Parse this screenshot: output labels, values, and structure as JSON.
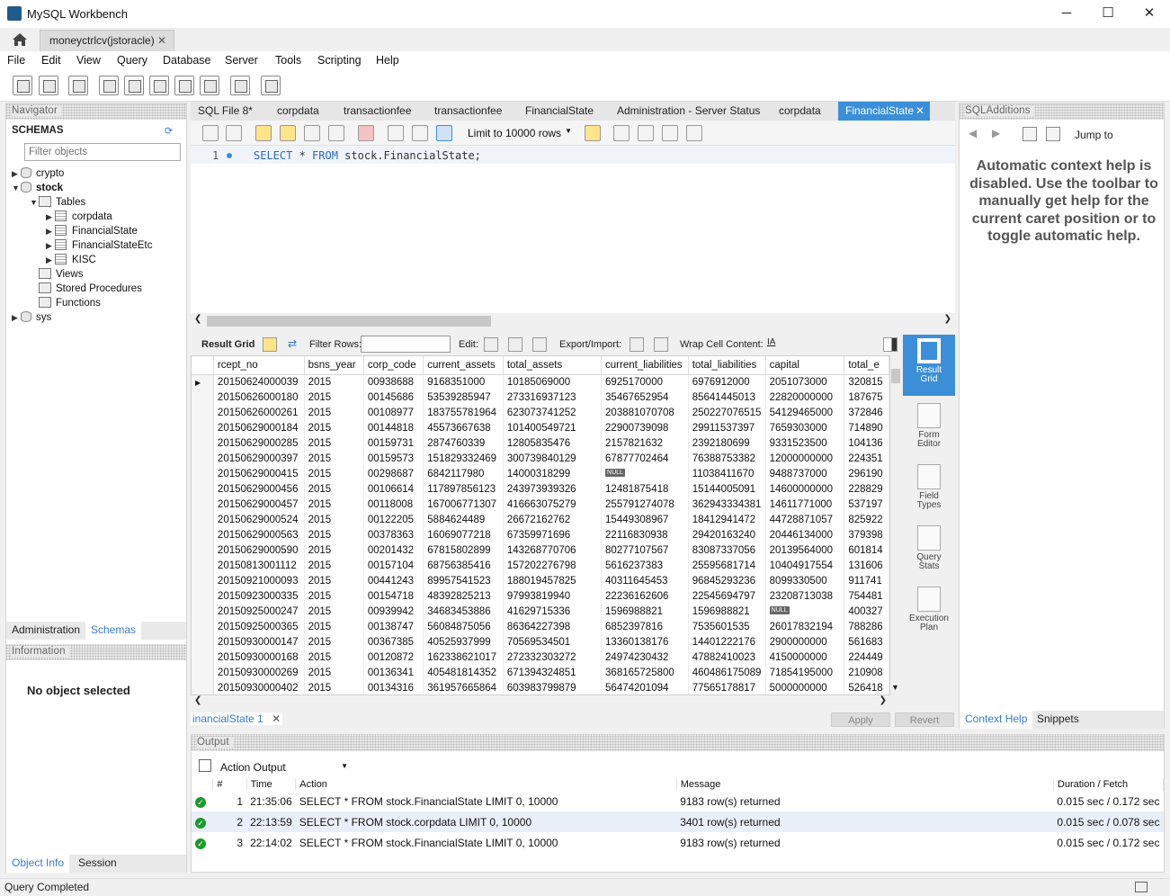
{
  "window": {
    "title": "MySQL Workbench",
    "minimize": "─",
    "maximize": "☐",
    "close": "✕"
  },
  "connection_tab": {
    "label": "moneyctrlcv(jstoracle)",
    "close": "✕"
  },
  "menu": [
    "File",
    "Edit",
    "View",
    "Query",
    "Database",
    "Server",
    "Tools",
    "Scripting",
    "Help"
  ],
  "navigator": {
    "title": "Navigator",
    "schemas_label": "SCHEMAS",
    "filter_placeholder": "Filter objects",
    "tree": {
      "crypto": "crypto",
      "stock": "stock",
      "tables": "Tables",
      "corpdata": "corpdata",
      "financialstate": "FinancialState",
      "financialstateetc": "FinancialStateEtc",
      "kisc": "KISC",
      "views": "Views",
      "procedures": "Stored Procedures",
      "functions": "Functions",
      "sys": "sys"
    },
    "tabs": [
      "Administration",
      "Schemas"
    ],
    "info_title": "Information",
    "no_object": "No object selected",
    "bottom_tabs": [
      "Object Info",
      "Session"
    ]
  },
  "editor_tabs": [
    "SQL File 8*",
    "corpdata",
    "transactionfee",
    "transactionfee",
    "FinancialState",
    "Administration - Server Status",
    "corpdata",
    "FinancialState"
  ],
  "editor": {
    "limit": "Limit to 10000 rows",
    "line_no": "1",
    "sql_kw1": "SELECT",
    "sql_star": " * ",
    "sql_kw2": "FROM",
    "sql_rest": " stock.FinancialState;"
  },
  "result_toolbar": {
    "result_grid": "Result Grid",
    "filter_rows": "Filter Rows:",
    "edit": "Edit:",
    "export_import": "Export/Import:",
    "wrap": "Wrap Cell Content:"
  },
  "grid": {
    "columns": [
      "rcept_no",
      "bsns_year",
      "corp_code",
      "current_assets",
      "total_assets",
      "current_liabilities",
      "total_liabilities",
      "capital",
      "total_e"
    ],
    "rows": [
      [
        "20150624000039",
        "2015",
        "00938688",
        "9168351000",
        "10185069000",
        "6925170000",
        "6976912000",
        "2051073000",
        "320815"
      ],
      [
        "20150626000180",
        "2015",
        "00145686",
        "53539285947",
        "273316937123",
        "35467652954",
        "85641445013",
        "22820000000",
        "187675"
      ],
      [
        "20150626000261",
        "2015",
        "00108977",
        "183755781964",
        "623073741252",
        "203881070708",
        "250227076515",
        "54129465000",
        "372846"
      ],
      [
        "20150629000184",
        "2015",
        "00144818",
        "45573667638",
        "101400549721",
        "22900739098",
        "29911537397",
        "7659303000",
        "714890"
      ],
      [
        "20150629000285",
        "2015",
        "00159731",
        "2874760339",
        "12805835476",
        "2157821632",
        "2392180699",
        "9331523500",
        "104136"
      ],
      [
        "20150629000397",
        "2015",
        "00159573",
        "151829332469",
        "300739840129",
        "67877702464",
        "76388753382",
        "12000000000",
        "224351"
      ],
      [
        "20150629000415",
        "2015",
        "00298687",
        "6842117980",
        "14000318299",
        "NULL",
        "11038411670",
        "9488737000",
        "296190"
      ],
      [
        "20150629000456",
        "2015",
        "00106614",
        "117897856123",
        "243973939326",
        "12481875418",
        "15144005091",
        "14600000000",
        "228829"
      ],
      [
        "20150629000457",
        "2015",
        "00118008",
        "167006771307",
        "416663075279",
        "255791274078",
        "362943334381",
        "14611771000",
        "537197"
      ],
      [
        "20150629000524",
        "2015",
        "00122205",
        "5884624489",
        "26672162762",
        "15449308967",
        "18412941472",
        "44728871057",
        "825922"
      ],
      [
        "20150629000563",
        "2015",
        "00378363",
        "16069077218",
        "67359971696",
        "22116830938",
        "29420163240",
        "20446134000",
        "379398"
      ],
      [
        "20150629000590",
        "2015",
        "00201432",
        "67815802899",
        "143268770706",
        "80277107567",
        "83087337056",
        "20139564000",
        "601814"
      ],
      [
        "20150813001112",
        "2015",
        "00157104",
        "68756385416",
        "157202276798",
        "5616237383",
        "25595681714",
        "10404917554",
        "131606"
      ],
      [
        "20150921000093",
        "2015",
        "00441243",
        "89957541523",
        "188019457825",
        "40311645453",
        "96845293236",
        "8099330500",
        "911741"
      ],
      [
        "20150923000335",
        "2015",
        "00154718",
        "48392825213",
        "97993819940",
        "22236162606",
        "22545694797",
        "23208713038",
        "754481"
      ],
      [
        "20150925000247",
        "2015",
        "00939942",
        "34683453886",
        "41629715336",
        "1596988821",
        "1596988821",
        "NULL",
        "400327"
      ],
      [
        "20150925000365",
        "2015",
        "00138747",
        "56084875056",
        "86364227398",
        "6852397816",
        "7535601535",
        "26017832194",
        "788286"
      ],
      [
        "20150930000147",
        "2015",
        "00367385",
        "40525937999",
        "70569534501",
        "13360138176",
        "14401222176",
        "2900000000",
        "561683"
      ],
      [
        "20150930000168",
        "2015",
        "00120872",
        "162338621017",
        "272332303272",
        "24974230432",
        "47882410023",
        "4150000000",
        "224449"
      ],
      [
        "20150930000269",
        "2015",
        "00136341",
        "405481814352",
        "671394324851",
        "368165725800",
        "460486175089",
        "71854195000",
        "210908"
      ],
      [
        "20150930000402",
        "2015",
        "00134316",
        "361957665864",
        "603983799879",
        "56474201094",
        "77565178817",
        "5000000000",
        "526418"
      ]
    ]
  },
  "side_buttons": [
    "Result Grid",
    "Form Editor",
    "Field Types",
    "Query Stats",
    "Execution Plan"
  ],
  "result_tab": {
    "label": "inancialState 1",
    "close": "✕",
    "apply": "Apply",
    "revert": "Revert"
  },
  "sqladditions": {
    "title": "SQLAdditions",
    "jump_to": "Jump to",
    "help": "Automatic context help is disabled. Use the toolbar to manually get help for the current caret position or to toggle automatic help.",
    "tabs": [
      "Context Help",
      "Snippets"
    ]
  },
  "output": {
    "title": "Output",
    "select": "Action Output",
    "columns": [
      "#",
      "Time",
      "Action",
      "Message",
      "Duration / Fetch"
    ],
    "rows": [
      [
        "1",
        "21:35:06",
        "SELECT * FROM stock.FinancialState LIMIT 0, 10000",
        "9183 row(s) returned",
        "0.015 sec / 0.172 sec"
      ],
      [
        "2",
        "22:13:59",
        "SELECT * FROM stock.corpdata LIMIT 0, 10000",
        "3401 row(s) returned",
        "0.015 sec / 0.078 sec"
      ],
      [
        "3",
        "22:14:02",
        "SELECT * FROM stock.FinancialState LIMIT 0, 10000",
        "9183 row(s) returned",
        "0.015 sec / 0.172 sec"
      ]
    ]
  },
  "status": "Query Completed",
  "colors": {
    "accent": "#3a8fd8",
    "ok": "#1a9a2a"
  }
}
